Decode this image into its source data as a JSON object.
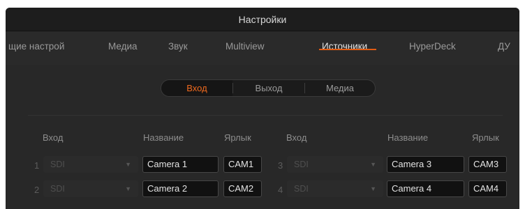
{
  "window": {
    "title": "Настройки"
  },
  "tabs": [
    {
      "label": "щие настрой",
      "active": false
    },
    {
      "label": "Медиа",
      "active": false
    },
    {
      "label": "Звук",
      "active": false
    },
    {
      "label": "Multiview",
      "active": false
    },
    {
      "label": "Источники",
      "active": true
    },
    {
      "label": "HyperDeck",
      "active": false
    },
    {
      "label": "ДУ",
      "active": false
    }
  ],
  "segments": [
    {
      "label": "Вход",
      "active": true
    },
    {
      "label": "Выход",
      "active": false
    },
    {
      "label": "Медиа",
      "active": false
    }
  ],
  "columns": {
    "left": {
      "input": "Вход",
      "name": "Название",
      "label": "Ярлык"
    },
    "right": {
      "input": "Вход",
      "name": "Название",
      "label": "Ярлык"
    }
  },
  "rows": [
    {
      "num": "1",
      "input": "SDI",
      "name": "Camera 1",
      "short": "CAM1"
    },
    {
      "num": "2",
      "input": "SDI",
      "name": "Camera 2",
      "short": "CAM2"
    },
    {
      "num": "3",
      "input": "SDI",
      "name": "Camera 3",
      "short": "CAM3"
    },
    {
      "num": "4",
      "input": "SDI",
      "name": "Camera 4",
      "short": "CAM4"
    }
  ],
  "colors": {
    "accent": "#e25c12",
    "background": "#262626",
    "field": "#111111"
  }
}
